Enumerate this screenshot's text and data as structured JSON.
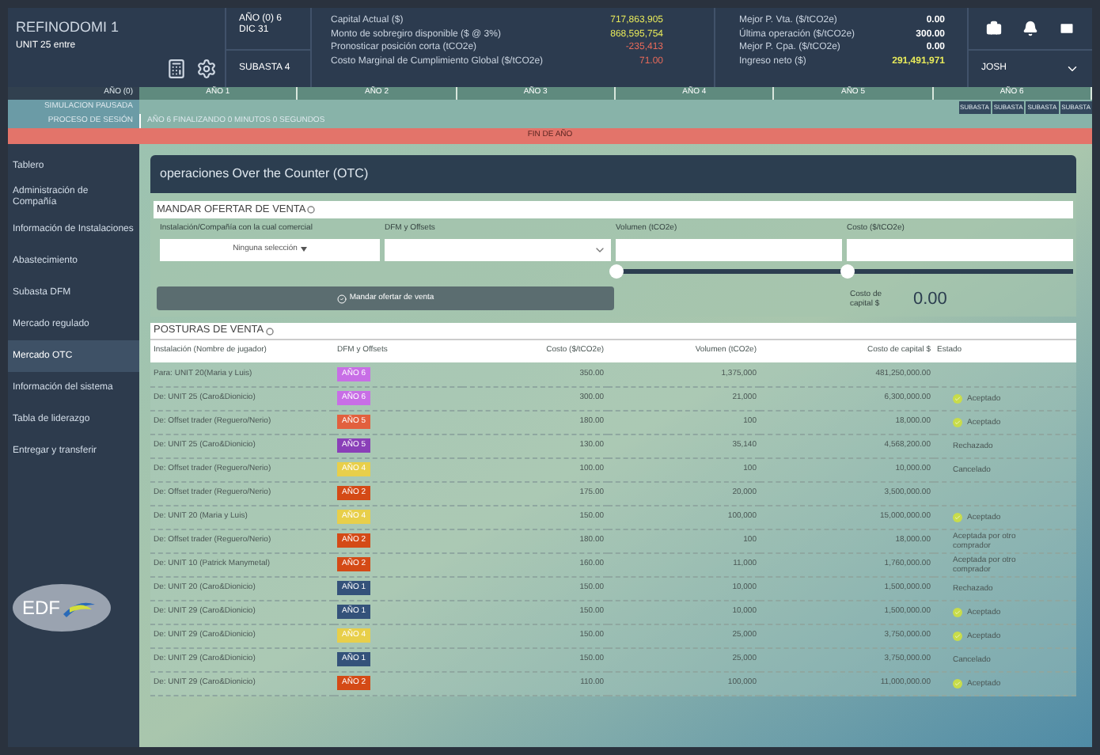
{
  "header": {
    "company": "REFINODOMI 1",
    "unit": "UNIT 25 entre",
    "year": "AÑO (0) 6",
    "date": "DIC 31",
    "auction": "SUBASTA 4",
    "metrics_left": [
      {
        "label": "Capital Actual ($)",
        "value": "717,863,905",
        "color": "#e8ea5a"
      },
      {
        "label": "Monto de sobregiro disponible ($ @ 3%)",
        "value": "868,595,754",
        "color": "#e8ea5a"
      },
      {
        "label": "Pronosticar posición corta (tCO2e)",
        "value": "-235,413",
        "color": "#e86a5a"
      },
      {
        "label": "Costo Marginal de Cumplimiento Global ($/tCO2e)",
        "value": "71.00",
        "color": "#e86a5a"
      }
    ],
    "metrics_right": [
      {
        "label": "Mejor P. Vta. ($/tCO2e)",
        "value": "0.00",
        "color": "#ffffff"
      },
      {
        "label": "Última operación ($/tCO2e)",
        "value": "300.00",
        "color": "#ffffff"
      },
      {
        "label": "Mejor P. Cpa. ($/tCO2e)",
        "value": "0.00",
        "color": "#ffffff"
      },
      {
        "label": "Ingreso neto ($)",
        "value": "291,491,971",
        "color": "#e8ea5a"
      }
    ],
    "user": "JOSH"
  },
  "timeline": {
    "start_label": "AÑO (0)",
    "years": [
      "AÑO 1",
      "AÑO 2",
      "AÑO 3",
      "AÑO 4",
      "AÑO 5",
      "AÑO 6"
    ],
    "status_label": "SIMULACION PAUSADA",
    "auction_buttons": [
      "SUBASTA",
      "SUBASTA",
      "SUBASTA",
      "SUBASTA"
    ],
    "session_label": "PROCESO DE SESIÓN",
    "session_text": "AÑO 6 FINALIZANDO 0 MINUTOS 0 SEGUNDOS",
    "banner": "FIN DE AÑO"
  },
  "sidebar": {
    "items": [
      {
        "label": "Tablero",
        "selected": false
      },
      {
        "label": "Administración de Compañía",
        "selected": false
      },
      {
        "label": "Información de Instalaciones",
        "selected": false
      },
      {
        "label": "Abastecimiento",
        "selected": false
      },
      {
        "label": "Subasta DFM",
        "selected": false
      },
      {
        "label": "Mercado regulado",
        "selected": false
      },
      {
        "label": "Mercado OTC",
        "selected": true
      },
      {
        "label": "Información del sistema",
        "selected": false
      },
      {
        "label": "Tabla de liderazgo",
        "selected": false
      },
      {
        "label": "Entregar y transferir",
        "selected": false
      }
    ],
    "logo": "EDF"
  },
  "panel": {
    "title": "operaciones Over the Counter (OTC)",
    "form": {
      "title": "MANDAR OFERTAR DE VENTA",
      "partner_label": "Instalación/Compañía con la cual comercial",
      "partner_placeholder": "Ninguna selección",
      "dfm_label": "DFM y Offsets",
      "volume_label": "Volumen (tCO2e)",
      "volume_slider": {
        "level": 0
      },
      "cost_label": "Costo ($/tCO2e)",
      "cost_slider": {
        "level": 0
      },
      "submit": "Mandar ofertar de venta",
      "capital_label": "Costo de capital $",
      "capital_value": "0.00"
    },
    "table": {
      "title": "POSTURAS DE VENTA",
      "columns": [
        "Instalación (Nombre de jugador)",
        "DFM y Offsets",
        "Costo ($/tCO2e)",
        "Volumen (tCO2e)",
        "Costo de capital $",
        "Estado"
      ],
      "rows": [
        {
          "player": "Para: UNIT 20(Maria y Luis)",
          "badge": "AÑO 6",
          "color": "#c86ee6",
          "cost": "350.00",
          "volume": "1,375,000",
          "capital": "481,250,000.00",
          "status": "",
          "accepted": false
        },
        {
          "player": "De: UNIT 25 (Caro&Dionicio)",
          "badge": "AÑO 6",
          "color": "#c86ee6",
          "cost": "300.00",
          "volume": "21,000",
          "capital": "6,300,000.00",
          "status": "Aceptado",
          "accepted": true
        },
        {
          "player": "De: Offset trader (Reguero/Nerio)",
          "badge": "AÑO 5",
          "color": "#e2603e",
          "cost": "180.00",
          "volume": "100",
          "capital": "18,000.00",
          "status": "Aceptado",
          "accepted": true
        },
        {
          "player": "De: UNIT 25 (Caro&Dionicio)",
          "badge": "AÑO 5",
          "color": "#8a3fb8",
          "cost": "130.00",
          "volume": "35,140",
          "capital": "4,568,200.00",
          "status": "Rechazado",
          "accepted": false
        },
        {
          "player": "De: Offset trader (Reguero/Nerio)",
          "badge": "AÑO 4",
          "color": "#e8cf4a",
          "cost": "100.00",
          "volume": "100",
          "capital": "10,000.00",
          "status": "Cancelado",
          "accepted": false
        },
        {
          "player": "De: Offset trader (Reguero/Nerio)",
          "badge": "AÑO 2",
          "color": "#d44a16",
          "cost": "175.00",
          "volume": "20,000",
          "capital": "3,500,000.00",
          "status": "",
          "accepted": false
        },
        {
          "player": "De: UNIT 20 (Maria y Luis)",
          "badge": "AÑO 4",
          "color": "#e8cf4a",
          "cost": "150.00",
          "volume": "100,000",
          "capital": "15,000,000.00",
          "status": "Aceptado",
          "accepted": true
        },
        {
          "player": "De: Offset trader (Reguero/Nerio)",
          "badge": "AÑO 2",
          "color": "#d44a16",
          "cost": "180.00",
          "volume": "100",
          "capital": "18,000.00",
          "status": "Aceptada por otro comprador",
          "accepted": false
        },
        {
          "player": "De: UNIT 10 (Patrick Manymetal)",
          "badge": "AÑO 2",
          "color": "#d44a16",
          "cost": "160.00",
          "volume": "11,000",
          "capital": "1,760,000.00",
          "status": "Aceptada por otro comprador",
          "accepted": false
        },
        {
          "player": "De: UNIT 20 (Caro&Dionicio)",
          "badge": "AÑO 1",
          "color": "#34527a",
          "cost": "150.00",
          "volume": "10,000",
          "capital": "1,500,000.00",
          "status": "Rechazado",
          "accepted": false
        },
        {
          "player": "De: UNIT 29 (Caro&Dionicio)",
          "badge": "AÑO 1",
          "color": "#34527a",
          "cost": "150.00",
          "volume": "10,000",
          "capital": "1,500,000.00",
          "status": "Aceptado",
          "accepted": true
        },
        {
          "player": "De: UNIT 29 (Caro&Dionicio)",
          "badge": "AÑO 4",
          "color": "#e8cf4a",
          "cost": "150.00",
          "volume": "25,000",
          "capital": "3,750,000.00",
          "status": "Aceptado",
          "accepted": true
        },
        {
          "player": "De: UNIT 29 (Caro&Dionicio)",
          "badge": "AÑO 1",
          "color": "#34527a",
          "cost": "150.00",
          "volume": "25,000",
          "capital": "3,750,000.00",
          "status": "Cancelado",
          "accepted": false
        },
        {
          "player": "De: UNIT 29 (Caro&Dionicio)",
          "badge": "AÑO 2",
          "color": "#d44a16",
          "cost": "110.00",
          "volume": "100,000",
          "capital": "11,000,000.00",
          "status": "Aceptado",
          "accepted": true
        }
      ]
    }
  }
}
